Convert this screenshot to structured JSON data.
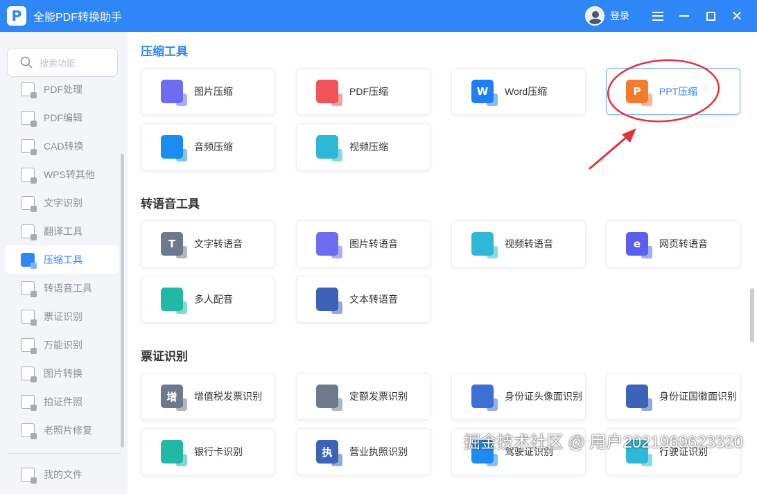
{
  "app": {
    "title": "全能PDF转换助手",
    "logo_letter": "P",
    "login_label": "登录"
  },
  "search": {
    "placeholder": "搜索功能"
  },
  "sidebar": {
    "items": [
      {
        "label": "PDF处理",
        "active": false
      },
      {
        "label": "PDF编辑",
        "active": false
      },
      {
        "label": "CAD转换",
        "active": false
      },
      {
        "label": "WPS转其他",
        "active": false
      },
      {
        "label": "文字识别",
        "active": false
      },
      {
        "label": "翻译工具",
        "active": false
      },
      {
        "label": "压缩工具",
        "active": true
      },
      {
        "label": "转语音工具",
        "active": false
      },
      {
        "label": "票证识别",
        "active": false
      },
      {
        "label": "万能识别",
        "active": false
      },
      {
        "label": "图片转换",
        "active": false
      },
      {
        "label": "拍证件照",
        "active": false
      },
      {
        "label": "老照片修复",
        "active": false
      }
    ],
    "footer_item": "我的文件"
  },
  "sections": [
    {
      "title": "压缩工具",
      "cards": [
        {
          "label": "图片压缩",
          "icon": "image-compress-icon",
          "color": "#6c6cf0"
        },
        {
          "label": "PDF压缩",
          "icon": "pdf-compress-icon",
          "color": "#f0535b"
        },
        {
          "label": "Word压缩",
          "icon": "word-compress-icon",
          "color": "#1f7ff0"
        },
        {
          "label": "PPT压缩",
          "icon": "ppt-compress-icon",
          "color": "#f27b2e",
          "highlighted": true
        },
        {
          "label": "音频压缩",
          "icon": "audio-compress-icon",
          "color": "#1c8cf2"
        },
        {
          "label": "视频压缩",
          "icon": "video-compress-icon",
          "color": "#2fb8d6"
        }
      ]
    },
    {
      "title": "转语音工具",
      "cards": [
        {
          "label": "文字转语音",
          "icon": "text-to-speech-icon",
          "color": "#6d7a8c"
        },
        {
          "label": "图片转语音",
          "icon": "image-to-speech-icon",
          "color": "#6c6cf0"
        },
        {
          "label": "视频转语音",
          "icon": "video-to-speech-icon",
          "color": "#2fb8d6"
        },
        {
          "label": "网页转语音",
          "icon": "webpage-to-speech-icon",
          "color": "#5b5ff0"
        },
        {
          "label": "多人配音",
          "icon": "multi-voice-icon",
          "color": "#23b8a6"
        },
        {
          "label": "文本转语音",
          "icon": "document-to-speech-icon",
          "color": "#3d63b8"
        }
      ]
    },
    {
      "title": "票证识别",
      "cards": [
        {
          "label": "增值税发票识别",
          "icon": "vat-invoice-icon",
          "color": "#6d7a8c"
        },
        {
          "label": "定额发票识别",
          "icon": "fixed-invoice-icon",
          "color": "#6d7a8c"
        },
        {
          "label": "身份证头像面识别",
          "icon": "id-card-front-icon",
          "color": "#3d6fd6"
        },
        {
          "label": "身份证国徽面识别",
          "icon": "id-card-back-icon",
          "color": "#3d63b8"
        },
        {
          "label": "银行卡识别",
          "icon": "bank-card-icon",
          "color": "#23b8a6"
        },
        {
          "label": "营业执照识别",
          "icon": "business-license-icon",
          "color": "#3d63b8"
        },
        {
          "label": "驾驶证识别",
          "icon": "driver-license-icon",
          "color": "#1c8cf2"
        },
        {
          "label": "行驶证识别",
          "icon": "vehicle-license-icon",
          "color": "#2fb8d6"
        }
      ]
    }
  ],
  "glyphs": {
    "vat": "增",
    "license": "执",
    "ppt": "P",
    "word": "W",
    "text": "T",
    "ie": "e"
  },
  "watermark": "掘金技术社区 @ 用户2021969623320"
}
